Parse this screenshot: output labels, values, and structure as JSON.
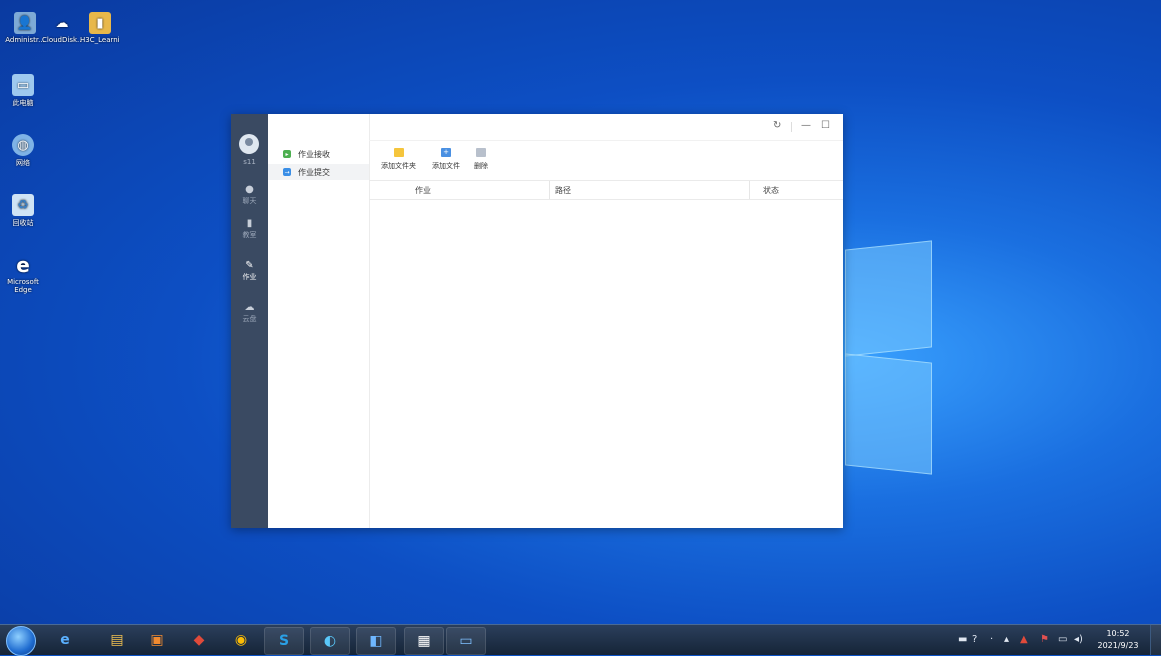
{
  "desktop": {
    "icons": [
      {
        "label": "Administr..."
      },
      {
        "label": "CloudDisk..."
      },
      {
        "label": "H3C_Learni..."
      },
      {
        "label": "此电脑"
      },
      {
        "label": "网络"
      },
      {
        "label": "回收站"
      },
      {
        "label": "Microsoft Edge"
      }
    ]
  },
  "app": {
    "user": {
      "name": "s11"
    },
    "rail": [
      {
        "label": "聊天",
        "icon": "chat-icon"
      },
      {
        "label": "教室",
        "icon": "classroom-icon"
      },
      {
        "label": "作业",
        "icon": "homework-icon",
        "active": true
      },
      {
        "label": "云盘",
        "icon": "cloud-icon"
      }
    ],
    "subnav": [
      {
        "label": "作业接收",
        "icon": "receive-icon",
        "color": "#4caf50"
      },
      {
        "label": "作业提交",
        "icon": "submit-icon",
        "color": "#3a8ee6",
        "active": true
      }
    ],
    "toolbar": {
      "add_folder": "添加文件夹",
      "add_file": "添加文件",
      "delete": "删除"
    },
    "table": {
      "columns": [
        "作业",
        "路径",
        "状态"
      ],
      "rows": []
    },
    "window_controls": [
      "refresh-icon",
      "minimize-icon",
      "maximize-icon"
    ]
  },
  "taskbar": {
    "apps": [
      "ie-icon",
      "explorer-icon",
      "media-icon",
      "app-icon",
      "chrome-icon",
      "skype-icon",
      "app-icon-2",
      "app-icon-3",
      "calendar-icon",
      "app-icon-4"
    ],
    "clock": {
      "time": "10:52",
      "date": "2021/9/23"
    }
  }
}
